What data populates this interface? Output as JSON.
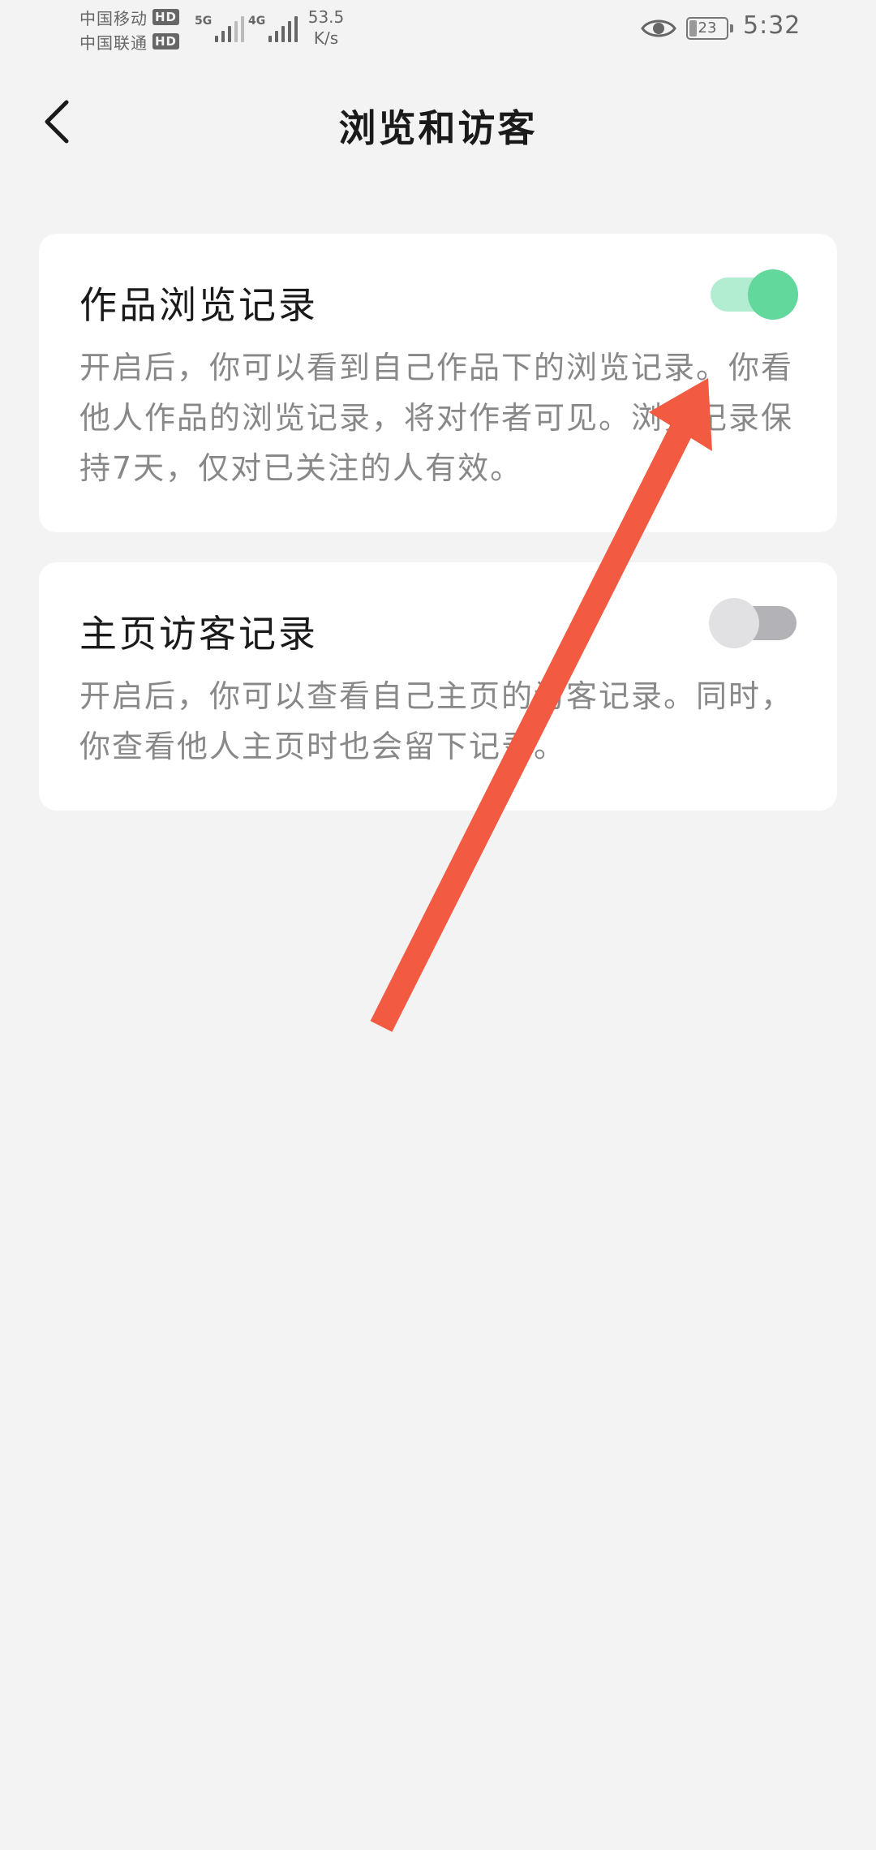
{
  "status_bar": {
    "carriers": [
      {
        "name": "中国移动",
        "badge": "HD"
      },
      {
        "name": "中国联通",
        "badge": "HD"
      }
    ],
    "network_types": [
      "5G",
      "4G"
    ],
    "speed_value": "53.5",
    "speed_unit": "K/s",
    "battery_level": "23",
    "time": "5:32"
  },
  "nav": {
    "title": "浏览和访客"
  },
  "settings": [
    {
      "title": "作品浏览记录",
      "description": "开启后，你可以看到自己作品下的浏览记录。你看他人作品的浏览记录，将对作者可见。浏览记录保持7天，仅对已关注的人有效。",
      "enabled": true
    },
    {
      "title": "主页访客记录",
      "description": "开启后，你可以查看自己主页的访客记录。同时，你查看他人主页时也会留下记录。",
      "enabled": false
    }
  ],
  "colors": {
    "toggle_on_knob": "#62d89c",
    "toggle_on_track": "#b2ecd1",
    "toggle_off_knob": "#e1e1e3",
    "toggle_off_track": "#b3b3b7",
    "annotation_arrow": "#f25a42"
  }
}
